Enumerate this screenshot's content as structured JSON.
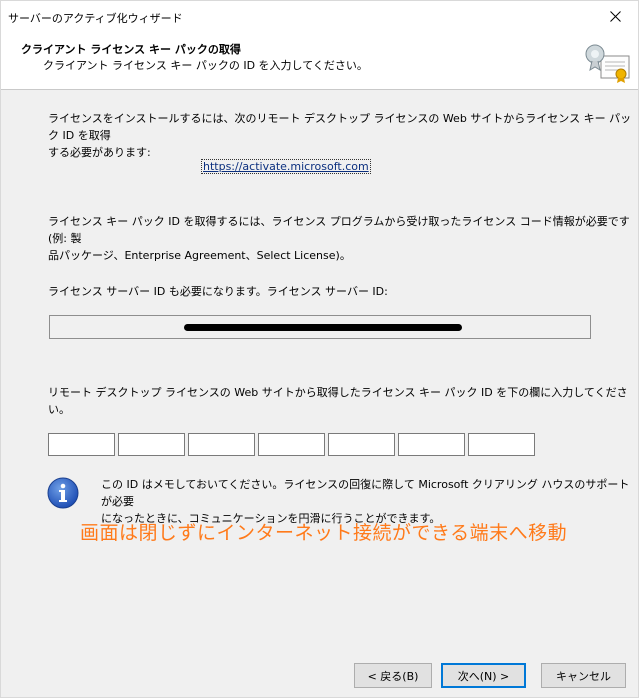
{
  "window": {
    "title": "サーバーのアクティブ化ウィザード"
  },
  "header": {
    "title": "クライアント ライセンス キー パックの取得",
    "subtitle": "クライアント ライセンス キー パックの ID を入力してください。",
    "icon": "certificate-icon"
  },
  "content": {
    "intro_line1": "ライセンスをインストールするには、次のリモート デスクトップ ライセンスの Web サイトからライセンス キー パック ID を取得",
    "intro_line2": "する必要があります:",
    "url": "https://activate.microsoft.com",
    "program_line1": "ライセンス キー パック ID を取得するには、ライセンス プログラムから受け取ったライセンス コード情報が必要です (例: 製",
    "program_line2": "品パッケージ、Enterprise Agreement、Select License)。",
    "server_id_label": "ライセンス サーバー ID も必要になります。ライセンス サーバー ID:",
    "server_id_value": "",
    "enter_id_label": "リモート デスクトップ ライセンスの Web サイトから取得したライセンス キー パック ID を下の欄に入力してください。",
    "key_fields": [
      "",
      "",
      "",
      "",
      "",
      "",
      ""
    ],
    "info_line1": "この ID はメモしておいてください。ライセンスの回復に際して Microsoft クリアリング ハウスのサポートが必要",
    "info_line2": "になったときに、コミュニケーションを円滑に行うことができます。",
    "annotation": "画面は閉じずにインターネット接続ができる端末へ移動"
  },
  "buttons": {
    "back": "< 戻る(B)",
    "next": "次へ(N) >",
    "cancel": "キャンセル"
  },
  "colors": {
    "annotation": "#ff7a1a",
    "link": "#0b2f7f",
    "default_button_border": "#0078d7"
  }
}
